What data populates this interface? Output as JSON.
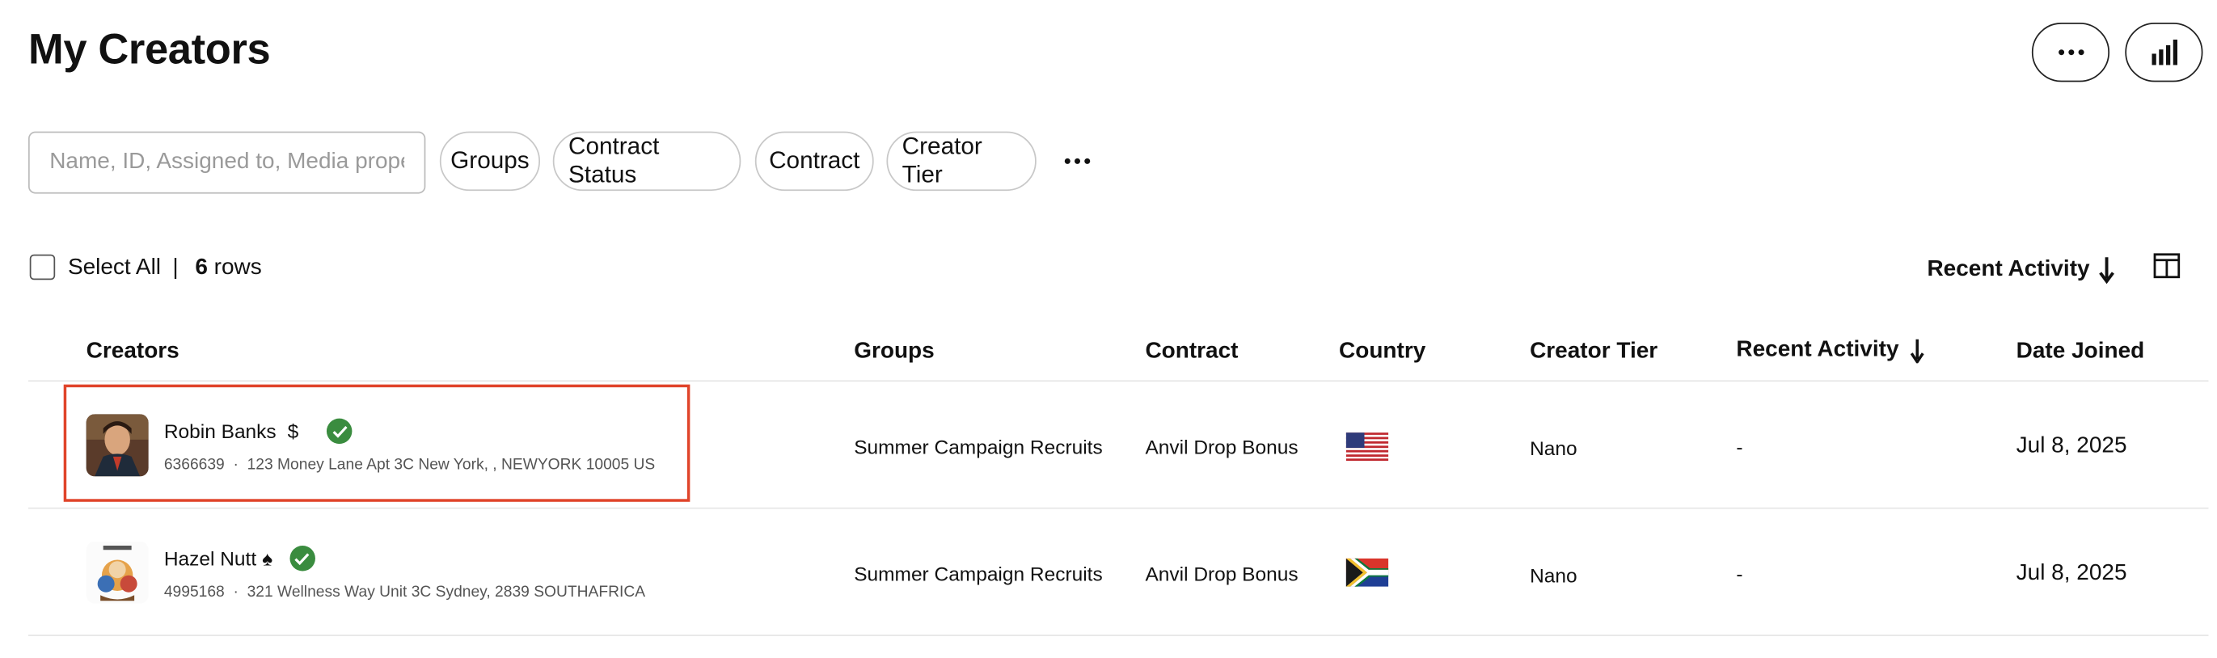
{
  "header": {
    "title": "My Creators"
  },
  "filters": {
    "search_placeholder": "Name, ID, Assigned to, Media property",
    "chips": [
      "Groups",
      "Contract Status",
      "Contract",
      "Creator Tier"
    ]
  },
  "selection": {
    "select_all_label": "Select All",
    "separator": "|",
    "rows_count": "6",
    "rows_label": "rows"
  },
  "sort": {
    "label": "Recent Activity"
  },
  "table": {
    "columns": [
      "Creators",
      "Groups",
      "Contract",
      "Country",
      "Creator Tier",
      "Recent Activity",
      "Date Joined"
    ],
    "rows": [
      {
        "name": "Robin Banks",
        "name_symbol": "$",
        "verified": true,
        "id": "6366639",
        "dot": "·",
        "address": "123 Money Lane Apt 3C New York, , NEWYORK 10005 US",
        "group": "Summer Campaign Recruits",
        "contract": "Anvil Drop Bonus",
        "country_flag": "us-flag-icon",
        "tier": "Nano",
        "recent_activity": "-",
        "date_joined": "Jul 8, 2025"
      },
      {
        "name": "Hazel Nutt",
        "name_symbol": "♠",
        "verified": true,
        "id": "4995168",
        "dot": "·",
        "address": "321 Wellness Way Unit 3C Sydney, 2839 SOUTHAFRICA",
        "group": "Summer Campaign Recruits",
        "contract": "Anvil Drop Bonus",
        "country_flag": "za-flag-icon",
        "tier": "Nano",
        "recent_activity": "-",
        "date_joined": "Jul 8, 2025"
      }
    ]
  },
  "colors": {
    "highlight": "#e0442a",
    "verified": "#3a8c3f"
  }
}
